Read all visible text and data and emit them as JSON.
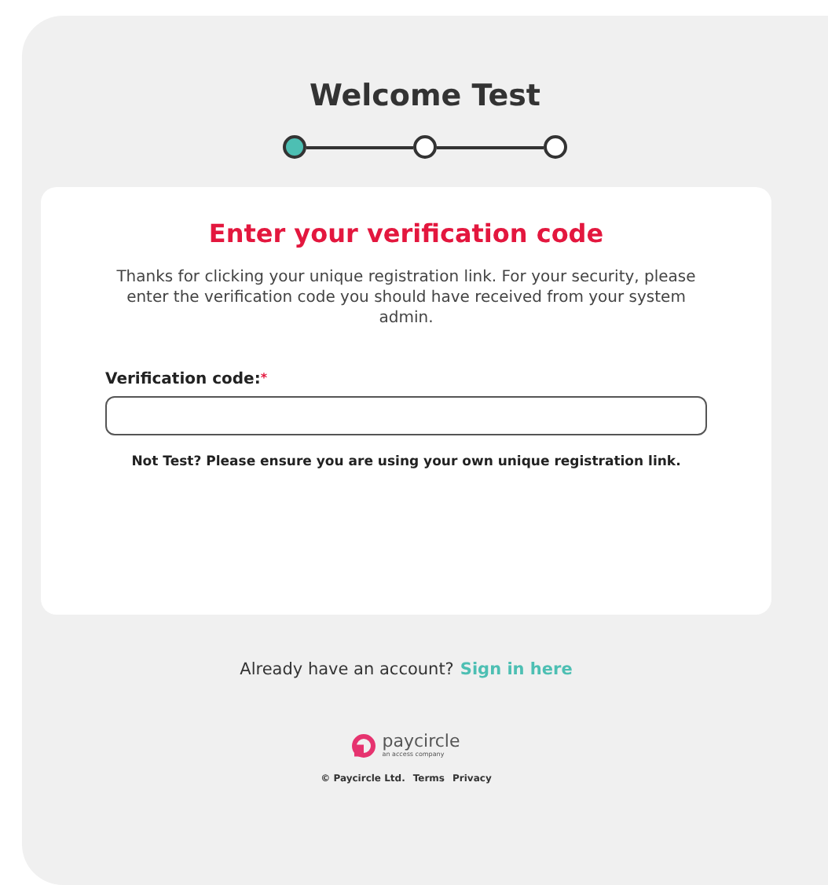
{
  "title": "Welcome Test",
  "steps": [
    {
      "selected": true
    },
    {
      "selected": false
    },
    {
      "selected": false
    }
  ],
  "card": {
    "heading": "Enter your verification code",
    "intro": "Thanks for clicking your unique registration link. For your security, please enter the verification code you should have received from your system admin.",
    "field": {
      "label": "Verification code:",
      "required_mark": "*"
    },
    "note": "Not Test? Please ensure you are using your own unique registration link."
  },
  "signin": {
    "text": "Already have an account?",
    "link": "Sign in here"
  },
  "logo": {
    "name": "paycircle",
    "tagline": "an access company"
  },
  "footer": {
    "copyright": "© Paycircle Ltd.",
    "links": [
      "Terms",
      "Privacy"
    ]
  }
}
